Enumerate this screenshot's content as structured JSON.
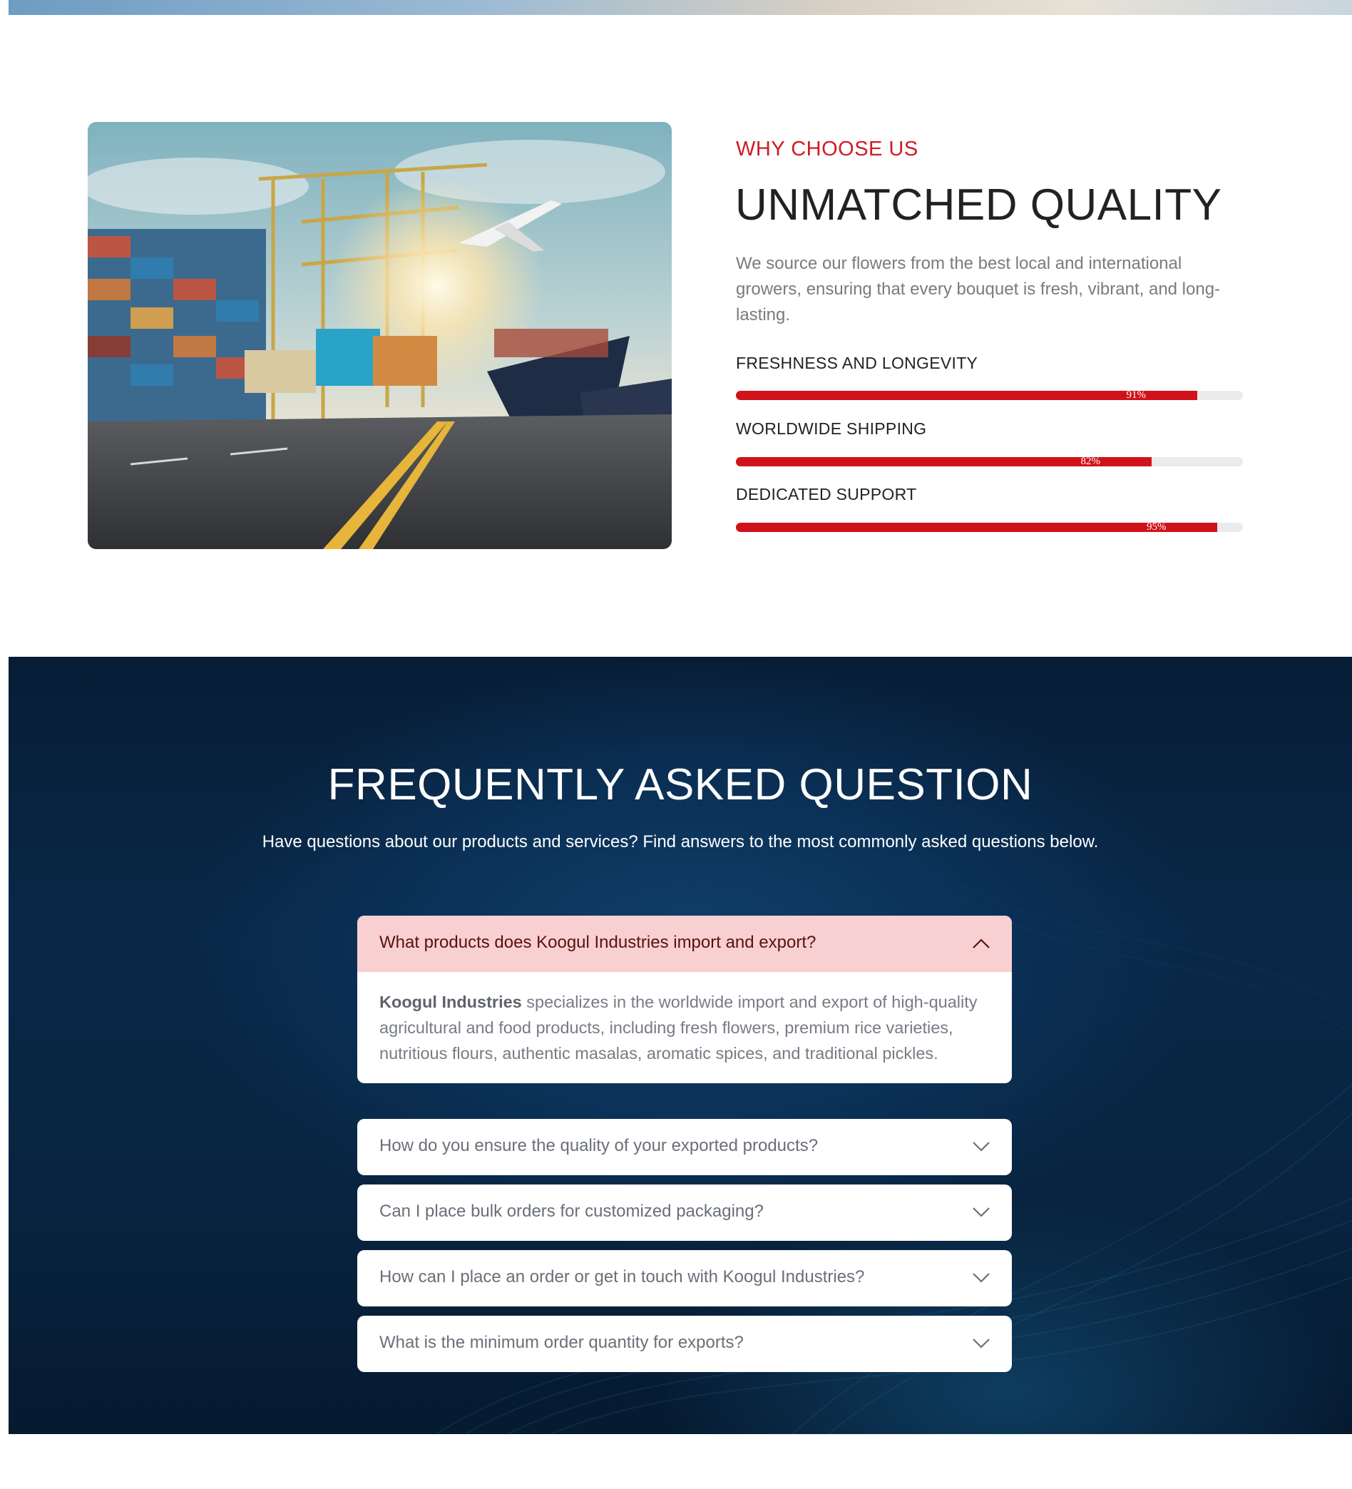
{
  "why": {
    "eyebrow": "WHY CHOOSE US",
    "title": "UNMATCHED QUALITY",
    "description": "We source our flowers from the best local and international growers, ensuring that every bouquet is fresh, vibrant, and long-lasting.",
    "skills": [
      {
        "label": "FRESHNESS AND LONGEVITY",
        "percent": 91,
        "percent_label": "91%"
      },
      {
        "label": "WORLDWIDE SHIPPING",
        "percent": 82,
        "percent_label": "82%"
      },
      {
        "label": "DEDICATED SUPPORT",
        "percent": 95,
        "percent_label": "95%"
      }
    ],
    "colors": {
      "accent": "#cf1b22",
      "track": "#ebebec"
    }
  },
  "faq": {
    "title": "FREQUENTLY ASKED QUESTION",
    "subtitle": "Have questions about our products and services? Find answers to the most commonly asked questions below.",
    "items": [
      {
        "question": "What products does Koogul Industries import and export?",
        "open": true,
        "icon": "chevron-up-icon",
        "answer_strong": "Koogul Industries",
        "answer_rest": " specializes in the worldwide import and export of high-quality agricultural and food products, including fresh flowers, premium rice varieties, nutritious flours, authentic masalas, aromatic spices, and traditional pickles."
      },
      {
        "question": "How do you ensure the quality of your exported products?",
        "open": false,
        "icon": "chevron-down-icon"
      },
      {
        "question": "Can I place bulk orders for customized packaging?",
        "open": false,
        "icon": "chevron-down-icon"
      },
      {
        "question": "How can I place an order or get in touch with Koogul Industries?",
        "open": false,
        "icon": "chevron-down-icon"
      },
      {
        "question": "What is the minimum order quantity for exports?",
        "open": false,
        "icon": "chevron-down-icon"
      }
    ],
    "colors": {
      "open_header": "#f8d0d1",
      "background": "#0a2a4a"
    }
  }
}
